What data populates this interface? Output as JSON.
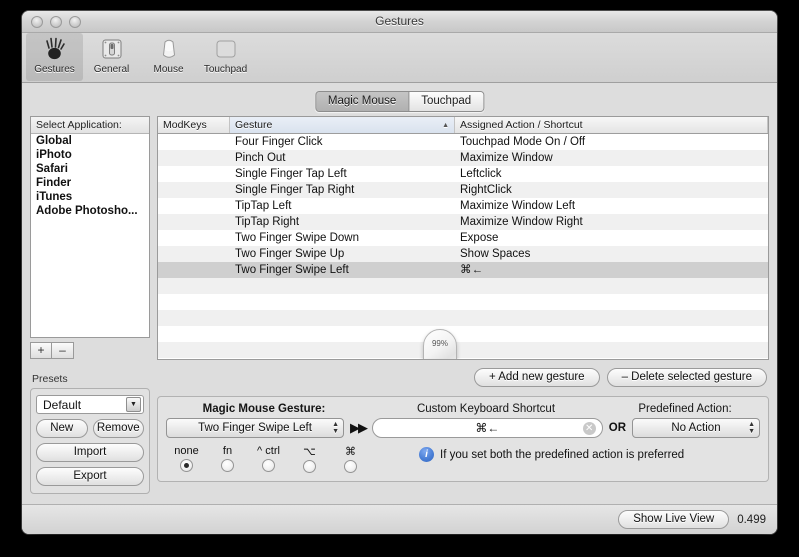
{
  "window": {
    "title": "Gestures",
    "traffic_lights": [
      "close-button",
      "minimize-button",
      "zoom-button"
    ]
  },
  "toolbar": {
    "items": [
      {
        "label": "Gestures",
        "icon": "hand-gesture-icon",
        "selected": true
      },
      {
        "label": "General",
        "icon": "switch-panel-icon",
        "selected": false
      },
      {
        "label": "Mouse",
        "icon": "magic-mouse-icon",
        "selected": false
      },
      {
        "label": "Touchpad",
        "icon": "touchpad-icon",
        "selected": false
      }
    ]
  },
  "tabs": {
    "items": [
      {
        "label": "Magic Mouse",
        "active": true
      },
      {
        "label": "Touchpad",
        "active": false
      }
    ]
  },
  "sidebar": {
    "header": "Select Application:",
    "apps": [
      "Global",
      "iPhoto",
      "Safari",
      "Finder",
      "iTunes",
      "Adobe Photosho..."
    ],
    "add_label": "+",
    "remove_label": "–"
  },
  "presets": {
    "label": "Presets",
    "selected": "Default",
    "new_label": "New",
    "remove_label": "Remove",
    "import_label": "Import",
    "export_label": "Export"
  },
  "table": {
    "columns": [
      "ModKeys",
      "Gesture",
      "Assigned Action / Shortcut"
    ],
    "sort_column": "Gesture",
    "sort_direction": "ascending",
    "rows": [
      {
        "modkeys": "",
        "gesture": "Four Finger Click",
        "action": "Touchpad Mode On / Off",
        "selected": false
      },
      {
        "modkeys": "",
        "gesture": "Pinch Out",
        "action": "Maximize Window",
        "selected": false
      },
      {
        "modkeys": "",
        "gesture": "Single Finger Tap Left",
        "action": "Leftclick",
        "selected": false
      },
      {
        "modkeys": "",
        "gesture": "Single Finger Tap Right",
        "action": "RightClick",
        "selected": false
      },
      {
        "modkeys": "",
        "gesture": "TipTap Left",
        "action": "Maximize Window Left",
        "selected": false
      },
      {
        "modkeys": "",
        "gesture": "TipTap Right",
        "action": "Maximize Window Right",
        "selected": false
      },
      {
        "modkeys": "",
        "gesture": "Two Finger Swipe Down",
        "action": "Expose",
        "selected": false
      },
      {
        "modkeys": "",
        "gesture": "Two Finger Swipe Up",
        "action": "Show Spaces",
        "selected": false
      },
      {
        "modkeys": "",
        "gesture": "Two Finger Swipe Left",
        "action": "⌘←",
        "selected": true
      }
    ],
    "empty_row_count": 7
  },
  "mouse_battery": {
    "percent": "99%"
  },
  "gesture_actions": {
    "add_label": "+ Add new gesture",
    "delete_label": "– Delete selected gesture"
  },
  "editor": {
    "gesture_heading": "Magic Mouse Gesture:",
    "gesture_value": "Two Finger Swipe Left",
    "shortcut_heading": "Custom Keyboard Shortcut",
    "shortcut_value": "⌘←",
    "or_label": "OR",
    "action_heading": "Predefined Action:",
    "action_value": "No Action",
    "modifiers": [
      {
        "label": "none",
        "selected": true
      },
      {
        "label": "fn",
        "selected": false
      },
      {
        "label": "^ ctrl",
        "selected": false
      },
      {
        "label": "⌥",
        "selected": false
      },
      {
        "label": "⌘",
        "selected": false
      }
    ],
    "note": "If you set both the predefined action is preferred"
  },
  "footer": {
    "live_view_label": "Show Live View",
    "version": "0.499"
  }
}
